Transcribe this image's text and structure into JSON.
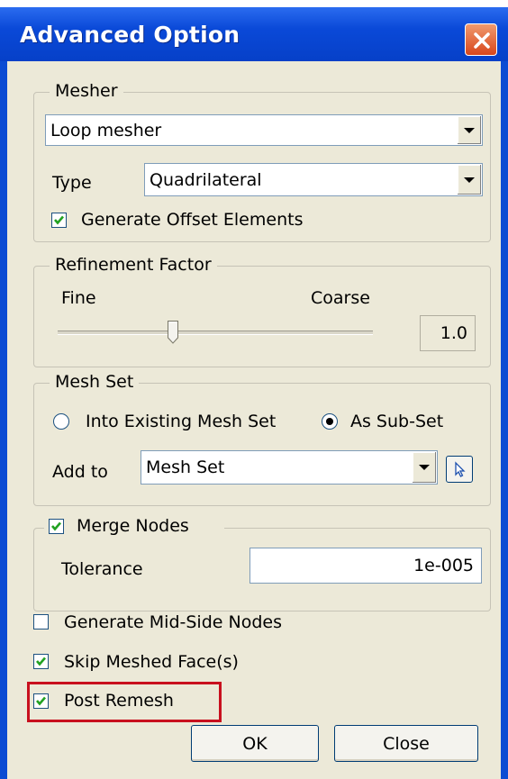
{
  "window": {
    "title": "Advanced Option"
  },
  "mesher": {
    "group_label": "Mesher",
    "mesher_value": "Loop mesher",
    "type_label": "Type",
    "type_value": "Quadrilateral",
    "offset_label": "Generate Offset Elements",
    "offset_checked": true
  },
  "refinement": {
    "group_label": "Refinement Factor",
    "fine_label": "Fine",
    "coarse_label": "Coarse",
    "value": "1.0",
    "slider_level": 0.36
  },
  "mesh_set": {
    "group_label": "Mesh Set",
    "radio_existing_label": "Into Existing Mesh Set",
    "radio_subset_label": "As Sub-Set",
    "selected": "As Sub-Set",
    "add_to_label": "Add to",
    "add_to_value": "Mesh Set"
  },
  "merge_nodes": {
    "label": "Merge Nodes",
    "checked": true,
    "tolerance_label": "Tolerance",
    "tolerance_value": "1e-005"
  },
  "options": {
    "mid_side_label": "Generate Mid-Side Nodes",
    "mid_side_checked": false,
    "skip_meshed_label": "Skip Meshed Face(s)",
    "skip_meshed_checked": true,
    "post_remesh_label": "Post Remesh",
    "post_remesh_checked": true
  },
  "buttons": {
    "ok": "OK",
    "close": "Close"
  },
  "colors": {
    "titlebar": "#0a49d8",
    "highlight": "#c8101e",
    "dialog_bg": "#ece9d8"
  }
}
